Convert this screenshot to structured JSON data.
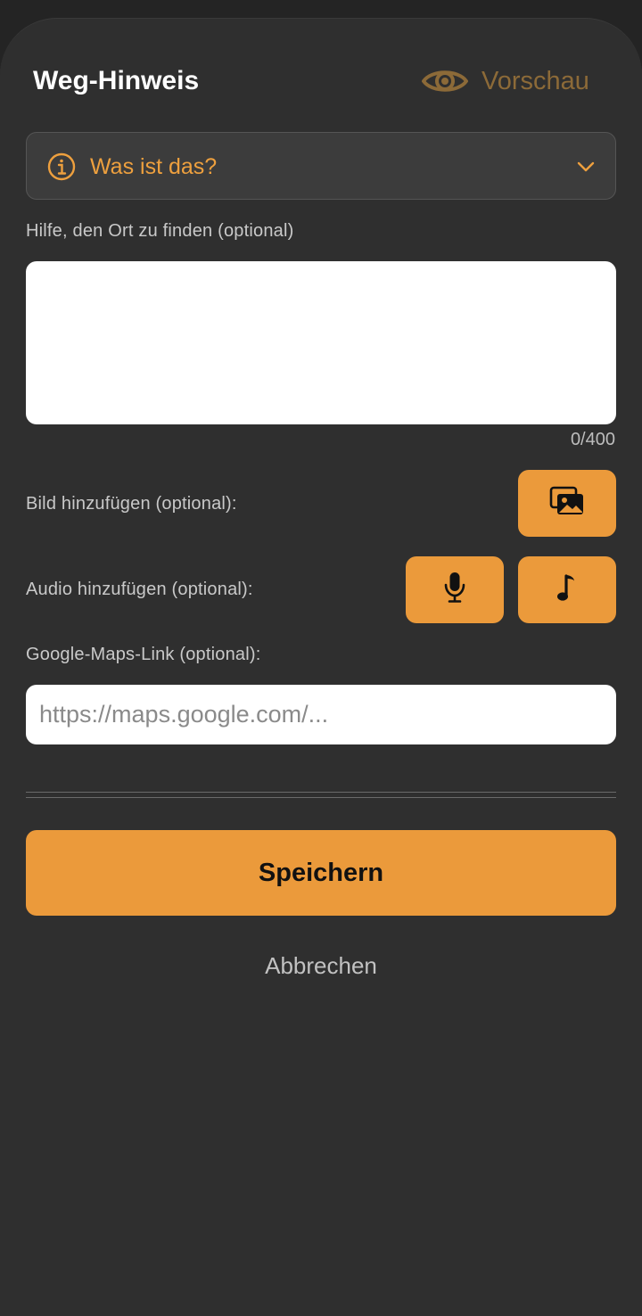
{
  "header": {
    "title": "Weg-Hinweis",
    "preview_label": "Vorschau"
  },
  "info_dropdown": {
    "label": "Was ist das?",
    "icon": "info-circle-icon",
    "chevron": "chevron-down-icon"
  },
  "hint_field": {
    "label": "Hilfe, den Ort zu finden (optional)",
    "value": "",
    "counter": "0/400"
  },
  "image_section": {
    "label": "Bild hinzufügen (optional):",
    "button_icon": "photo-gallery-icon"
  },
  "audio_section": {
    "label": "Audio hinzufügen (optional):",
    "record_icon": "microphone-icon",
    "music_icon": "music-note-icon"
  },
  "maps_section": {
    "label": "Google-Maps-Link (optional):",
    "placeholder": "https://maps.google.com/..."
  },
  "actions": {
    "save_label": "Speichern",
    "cancel_label": "Abbrechen"
  },
  "colors": {
    "accent": "#eb9a3b",
    "accent_text": "#eea03e",
    "preview_muted": "#8c6a38",
    "sheet_bg": "#2f2f2f"
  }
}
